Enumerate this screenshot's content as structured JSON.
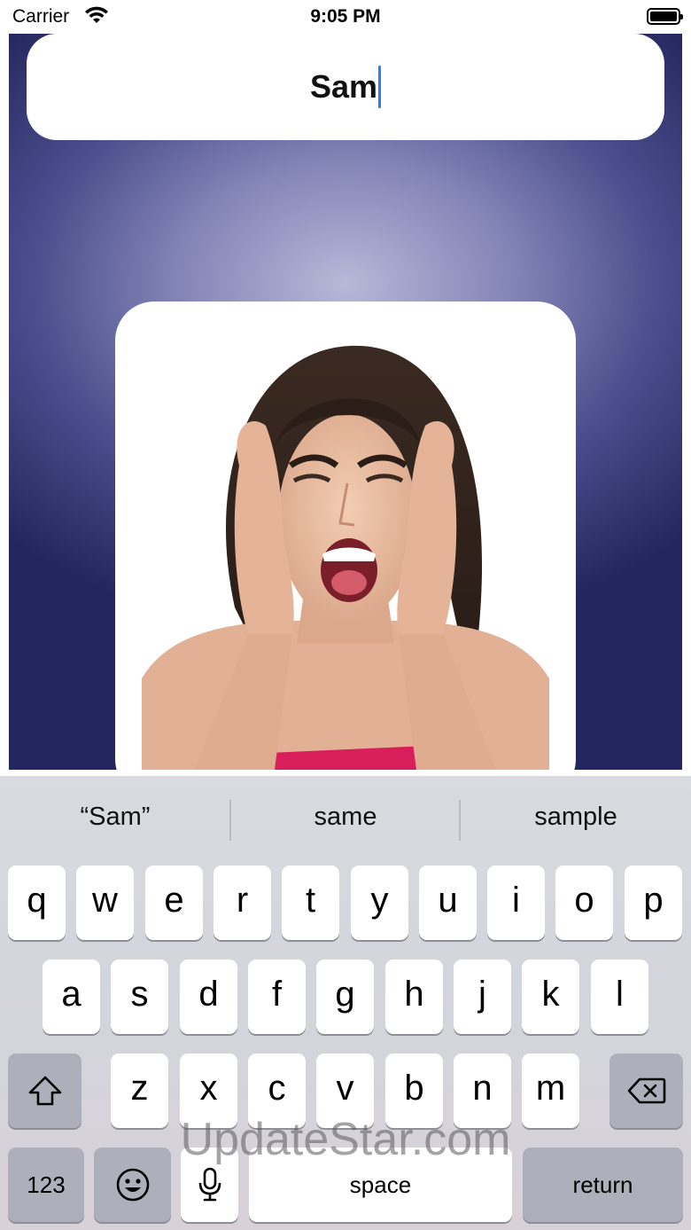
{
  "status_bar": {
    "carrier": "Carrier",
    "time": "9:05 PM"
  },
  "app": {
    "name_field_value": "Sam",
    "photo_icon": "screaming-woman-photo"
  },
  "keyboard": {
    "suggestions": [
      "“Sam”",
      "same",
      "sample"
    ],
    "row1": [
      "q",
      "w",
      "e",
      "r",
      "t",
      "y",
      "u",
      "i",
      "o",
      "p"
    ],
    "row2": [
      "a",
      "s",
      "d",
      "f",
      "g",
      "h",
      "j",
      "k",
      "l"
    ],
    "row3": [
      "z",
      "x",
      "c",
      "v",
      "b",
      "n",
      "m"
    ],
    "numbers_label": "123",
    "space_label": "space",
    "return_label": "return",
    "shift_icon": "shift-icon",
    "delete_icon": "delete-icon",
    "emoji_icon": "emoji-icon",
    "mic_icon": "microphone-icon"
  },
  "watermark": "UpdateStar.com"
}
